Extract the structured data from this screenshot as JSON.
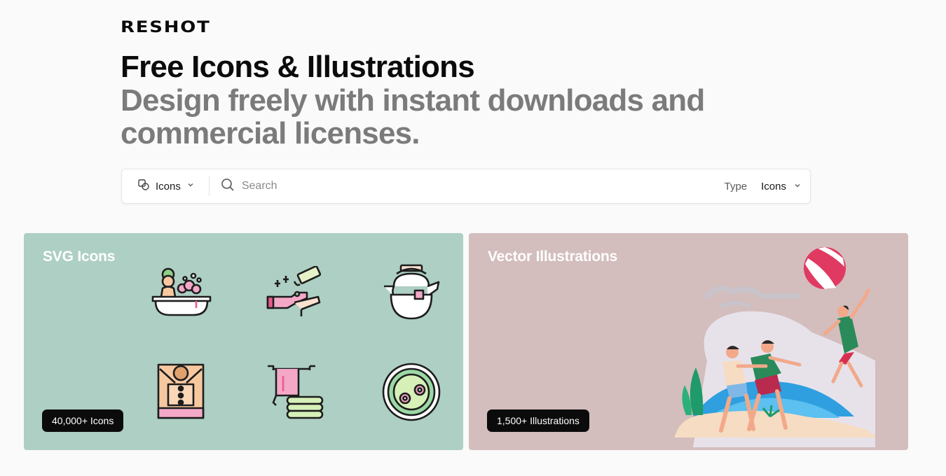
{
  "brand": {
    "logo": "RESHOT"
  },
  "hero": {
    "title": "Free Icons & Illustrations",
    "subtitle": "Design freely with instant downloads and commercial licenses."
  },
  "search": {
    "asset_type": "Icons",
    "placeholder": "Search",
    "type_label": "Type",
    "type_value": "Icons"
  },
  "cards": {
    "icons": {
      "title": "SVG Icons",
      "badge": "40,000+ Icons",
      "bg": "#aecfc3"
    },
    "illustrations": {
      "title": "Vector Illustrations",
      "badge": "1,500+ Illustrations",
      "bg": "#d3bdbd"
    }
  },
  "icons": [
    "bath-spa-icon",
    "hand-washing-icon",
    "teapot-icon",
    "massage-icon",
    "towel-rack-icon",
    "plate-flowers-icon"
  ]
}
